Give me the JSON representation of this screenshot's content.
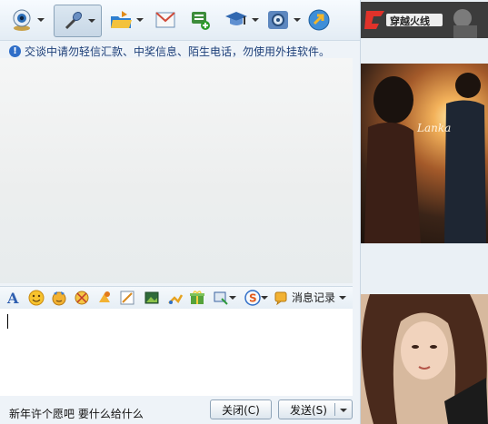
{
  "toolbar": {
    "buttons": [
      "video-call",
      "voice-call",
      "send-file",
      "send-email",
      "create-discussion-group",
      "app-store",
      "more-tools",
      "remote-assist"
    ]
  },
  "notice": {
    "text": "交谈中请勿轻信汇款、中奖信息、陌生电话，勿使用外挂软件。"
  },
  "format_bar": {
    "message_record_label": "消息记录"
  },
  "bottom": {
    "status_text": "新年许个愿吧 要什么给什么",
    "close_label": "关闭(C)",
    "send_label": "发送(S)"
  },
  "sidebar": {
    "banner_text": "穿越火线",
    "photo_caption": "Lanka"
  },
  "colors": {
    "accent": "#2f6ec8",
    "panel": "#eef3f8",
    "border": "#8fa4b8"
  }
}
